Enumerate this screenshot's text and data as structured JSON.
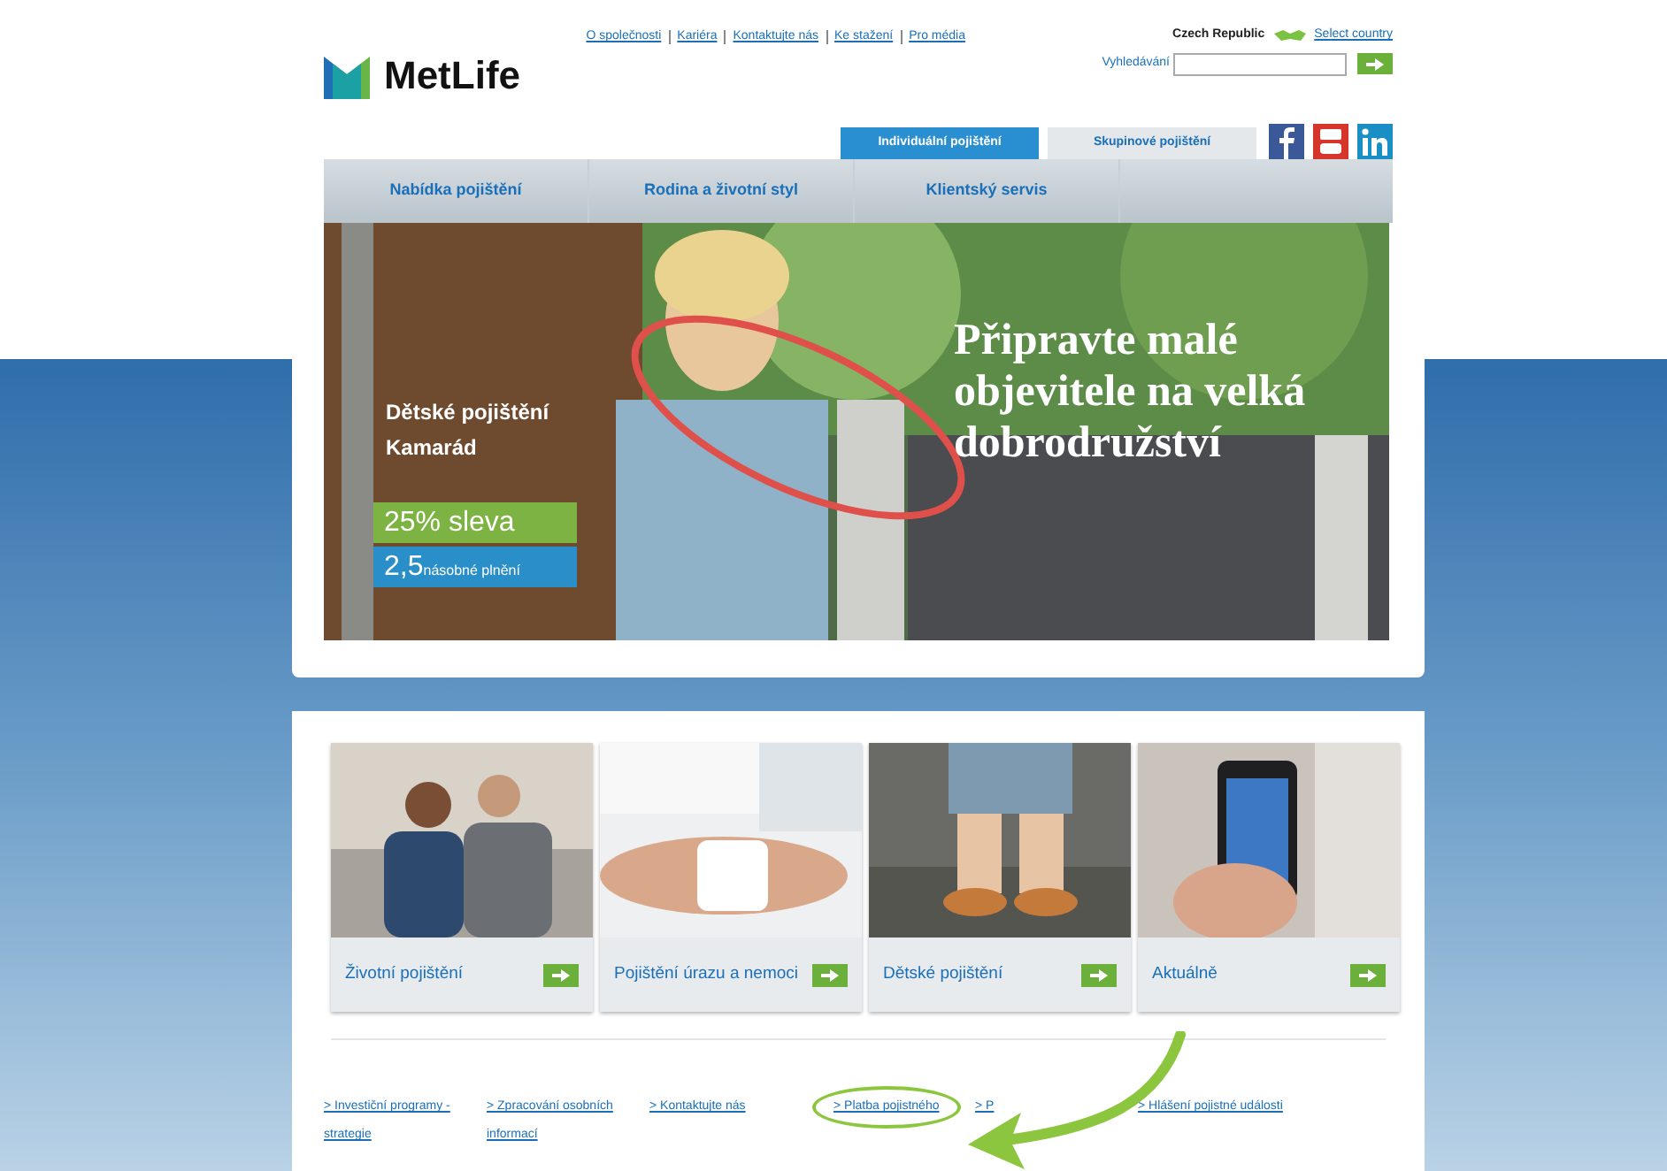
{
  "header": {
    "logo": "MetLife",
    "top_links": [
      "O společnosti",
      "Kariéra",
      "Kontaktujte nás",
      "Ke stažení",
      "Pro média"
    ],
    "country": "Czech Republic",
    "select_country": "Select country",
    "search": {
      "label": "Vyhledávání"
    }
  },
  "audience_tabs": [
    {
      "label": "Individuální pojištění",
      "selected": true
    },
    {
      "label": "Skupinové pojištění",
      "selected": false
    }
  ],
  "social": [
    {
      "kind": "facebook",
      "color": "#3b5998"
    },
    {
      "kind": "youtube",
      "color": "#d6352b"
    },
    {
      "kind": "linkedin",
      "color": "#1a8fc6"
    }
  ],
  "nav": [
    "Nabídka pojištění",
    "Rodina a životní styl",
    "Klientský servis"
  ],
  "hero": {
    "product": [
      "Dětské pojištění",
      "Kamarád"
    ],
    "discount": "25% sleva",
    "multiple": "2,5",
    "multiple_rest": "násobné plnění",
    "headline": [
      "Připravte malé",
      "objevitele na velká",
      "dobrodružství"
    ]
  },
  "cards": [
    {
      "label": "Životní pojištění"
    },
    {
      "label": "Pojištění úrazu a nemoci"
    },
    {
      "label": "Dětské pojištění"
    },
    {
      "label": "Aktuálně"
    }
  ],
  "footer_links": [
    {
      "lines": [
        "> Investiční programy -",
        "strategie"
      ],
      "highlighted": false
    },
    {
      "lines": [
        "> Zpracování osobních",
        "informací"
      ],
      "highlighted": false
    },
    {
      "lines": [
        "> Kontaktujte nás"
      ],
      "highlighted": false
    },
    {
      "lines": [
        "> Platba pojistného"
      ],
      "highlighted": true
    },
    {
      "lines": [
        "> P"
      ],
      "highlighted": false
    },
    {
      "lines": [
        "> Hlášení pojistné události"
      ],
      "highlighted": false
    }
  ]
}
